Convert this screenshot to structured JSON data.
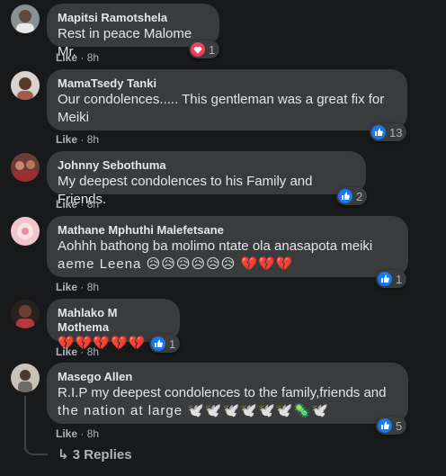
{
  "comments": [
    {
      "name": "Mapitsi Ramotshela",
      "text": "Rest in peace Malome Mr.",
      "like": "Like",
      "time": "8h",
      "reaction": "love",
      "count": "1"
    },
    {
      "name": "MamaTsedy Tanki",
      "text1": "Our condolences..... This gentleman was a great fix for",
      "text2": "Meiki",
      "like": "Like",
      "time": "8h",
      "reaction": "like",
      "count": "13"
    },
    {
      "name": "Johnny Sebothuma",
      "text": "My deepest condolences to his Family and Friends.",
      "like": "Like",
      "time": "8h",
      "reaction": "like",
      "count": "2"
    },
    {
      "name": "Mathane Mphuthi Malefetsane",
      "text1": "Aohhh bathong ba molimo ntate ola anasapota meiki",
      "text2": "aeme Leena 😥😥😥😥😥😥 💔💔💔",
      "like": "Like",
      "time": "8h",
      "reaction": "like",
      "count": "1"
    },
    {
      "name": "Mahlako M Mothema",
      "text": "💔💔💔💔💔",
      "like": "Like",
      "time": "8h",
      "reaction": "like",
      "count": "1"
    },
    {
      "name": "Masego Allen",
      "text1": "R.I.P my deepest condolences to the family,friends and",
      "text2": "the nation at large 🕊️🕊️🕊️🕊️🕊️🕊️🦠🕊️",
      "like": "Like",
      "time": "8h",
      "reaction": "like",
      "count": "5"
    }
  ],
  "replies": {
    "label": "3 Replies"
  },
  "separator": "·",
  "colors": {
    "bg": "#18191a",
    "bubble": "#3a3b3c",
    "like": "#1877f2",
    "love": "#f33e58"
  }
}
